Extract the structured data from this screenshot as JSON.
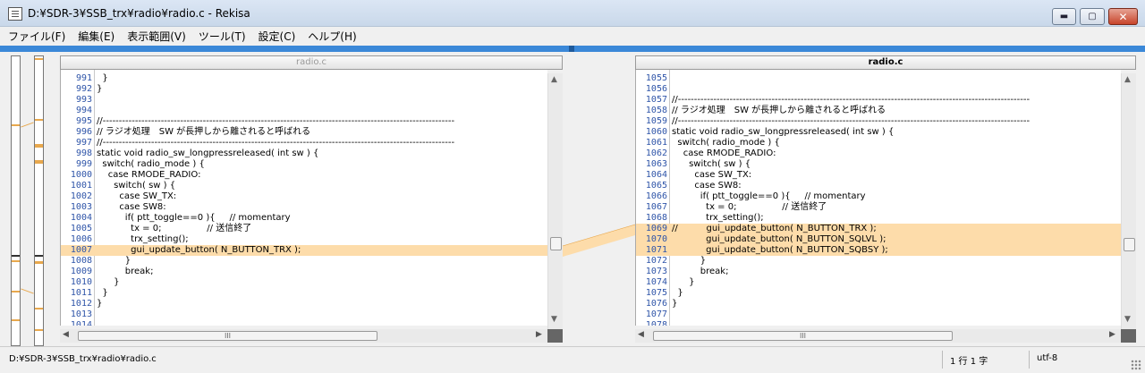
{
  "window": {
    "title": "D:¥SDR-3¥SSB_trx¥radio¥radio.c - Rekisa",
    "minimize": "▬",
    "maximize": "▢",
    "close": "✕"
  },
  "menu": [
    {
      "label": "ファイル(F)"
    },
    {
      "label": "編集(E)"
    },
    {
      "label": "表示範囲(V)"
    },
    {
      "label": "ツール(T)"
    },
    {
      "label": "設定(C)"
    },
    {
      "label": "ヘルプ(H)"
    }
  ],
  "left_pane": {
    "filename": "radio.c",
    "rows": [
      {
        "ln": "991",
        "code": "  }",
        "hl": false
      },
      {
        "ln": "992",
        "code": "}",
        "hl": false
      },
      {
        "ln": "993",
        "code": "",
        "hl": false
      },
      {
        "ln": "994",
        "code": "",
        "hl": false
      },
      {
        "ln": "995",
        "code": "//-------------------------------------------------------------------------------------------------------------",
        "hl": false
      },
      {
        "ln": "996",
        "code": "// ラジオ処理　SW が長押しから離されると呼ばれる",
        "hl": false
      },
      {
        "ln": "997",
        "code": "//-------------------------------------------------------------------------------------------------------------",
        "hl": false
      },
      {
        "ln": "998",
        "code": "static void radio_sw_longpressreleased( int sw ) {",
        "hl": false
      },
      {
        "ln": "999",
        "code": "  switch( radio_mode ) {",
        "hl": false
      },
      {
        "ln": "1000",
        "code": "    case RMODE_RADIO:",
        "hl": false
      },
      {
        "ln": "1001",
        "code": "      switch( sw ) {",
        "hl": false
      },
      {
        "ln": "1002",
        "code": "        case SW_TX:",
        "hl": false
      },
      {
        "ln": "1003",
        "code": "        case SW8:",
        "hl": false
      },
      {
        "ln": "1004",
        "code": "          if( ptt_toggle==0 ){     // momentary",
        "hl": false
      },
      {
        "ln": "1005",
        "code": "            tx = 0;                // 送信終了",
        "hl": false
      },
      {
        "ln": "1006",
        "code": "            trx_setting();",
        "hl": false
      },
      {
        "ln": "1007",
        "code": "            gui_update_button( N_BUTTON_TRX );",
        "hl": true
      },
      {
        "ln": "1008",
        "code": "          }",
        "hl": false
      },
      {
        "ln": "1009",
        "code": "          break;",
        "hl": false
      },
      {
        "ln": "1010",
        "code": "      }",
        "hl": false
      },
      {
        "ln": "1011",
        "code": "  }",
        "hl": false
      },
      {
        "ln": "1012",
        "code": "}",
        "hl": false
      },
      {
        "ln": "1013",
        "code": "",
        "hl": false
      },
      {
        "ln": "1014",
        "code": "",
        "hl": false
      }
    ]
  },
  "right_pane": {
    "filename": "radio.c",
    "rows": [
      {
        "ln": "1055",
        "code": "",
        "hl": false
      },
      {
        "ln": "1056",
        "code": "",
        "hl": false
      },
      {
        "ln": "1057",
        "code": "//-------------------------------------------------------------------------------------------------------------",
        "hl": false
      },
      {
        "ln": "1058",
        "code": "// ラジオ処理　SW が長押しから離されると呼ばれる",
        "hl": false
      },
      {
        "ln": "1059",
        "code": "//-------------------------------------------------------------------------------------------------------------",
        "hl": false
      },
      {
        "ln": "1060",
        "code": "static void radio_sw_longpressreleased( int sw ) {",
        "hl": false
      },
      {
        "ln": "1061",
        "code": "  switch( radio_mode ) {",
        "hl": false
      },
      {
        "ln": "1062",
        "code": "    case RMODE_RADIO:",
        "hl": false
      },
      {
        "ln": "1063",
        "code": "      switch( sw ) {",
        "hl": false
      },
      {
        "ln": "1064",
        "code": "        case SW_TX:",
        "hl": false
      },
      {
        "ln": "1065",
        "code": "        case SW8:",
        "hl": false
      },
      {
        "ln": "1066",
        "code": "          if( ptt_toggle==0 ){     // momentary",
        "hl": false
      },
      {
        "ln": "1067",
        "code": "            tx = 0;                // 送信終了",
        "hl": false
      },
      {
        "ln": "1068",
        "code": "            trx_setting();",
        "hl": false
      },
      {
        "ln": "1069",
        "code": "//          gui_update_button( N_BUTTON_TRX );",
        "hl": true
      },
      {
        "ln": "1070",
        "code": "            gui_update_button( N_BUTTON_SQLVL );",
        "hl": true
      },
      {
        "ln": "1071",
        "code": "            gui_update_button( N_BUTTON_SQBSY );",
        "hl": true
      },
      {
        "ln": "1072",
        "code": "          }",
        "hl": false
      },
      {
        "ln": "1073",
        "code": "          break;",
        "hl": false
      },
      {
        "ln": "1074",
        "code": "      }",
        "hl": false
      },
      {
        "ln": "1075",
        "code": "  }",
        "hl": false
      },
      {
        "ln": "1076",
        "code": "}",
        "hl": false
      },
      {
        "ln": "1077",
        "code": "",
        "hl": false
      },
      {
        "ln": "1078",
        "code": "",
        "hl": false
      }
    ]
  },
  "scroll": {
    "up_arrow": "▲",
    "down_arrow": "▼",
    "left_arrow": "◀",
    "right_arrow": "▶",
    "grip": "III"
  },
  "status": {
    "path": "D:¥SDR-3¥SSB_trx¥radio¥radio.c",
    "position": "1 行 1 字",
    "encoding": "utf-8"
  },
  "colors": {
    "diff_highlight": "#fddcaa",
    "line_number": "#2e54a8",
    "accent_bar": "#3b88d8"
  }
}
